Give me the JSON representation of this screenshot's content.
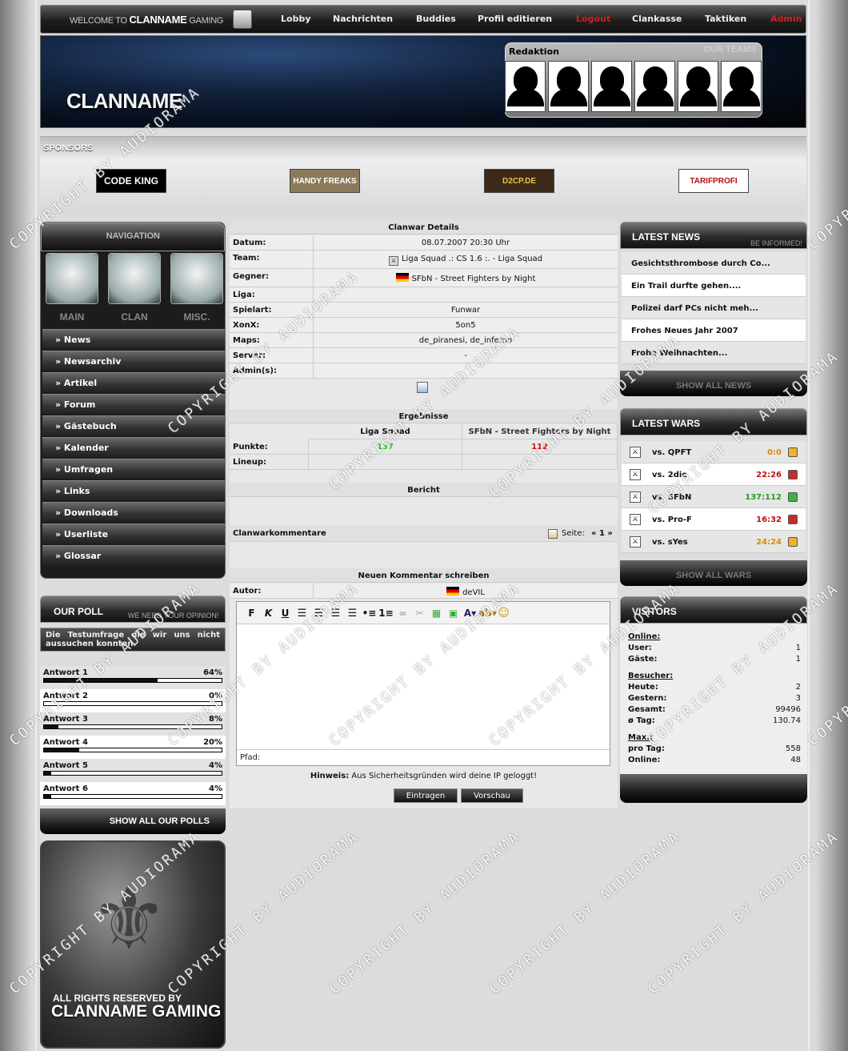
{
  "topnav": {
    "welcome_prefix": "WELCOME TO",
    "welcome_name": "CLANNAME",
    "welcome_suffix": "GAMING",
    "items": [
      "Lobby",
      "Nachrichten",
      "Buddies",
      "Profil editieren",
      "Logout",
      "Clankasse",
      "Taktiken",
      "Admin"
    ]
  },
  "header": {
    "logo": "CLANNAME",
    "redaktion": "Redaktion",
    "our_teams": "OUR TEAMS"
  },
  "sponsors": {
    "title": "SPONSORS",
    "items": [
      "CODE KING",
      "HANDY FREAKS",
      "D2CP.DE",
      "TARIFPROFI"
    ]
  },
  "nav": {
    "title": "NAVIGATION",
    "categories": [
      "MAIN",
      "CLAN",
      "MISC."
    ],
    "items": [
      "» News",
      "» Newsarchiv",
      "» Artikel",
      "» Forum",
      "» Gästebuch",
      "» Kalender",
      "» Umfragen",
      "» Links",
      "» Downloads",
      "» Userliste",
      "» Glossar"
    ]
  },
  "poll": {
    "title": "OUR POLL",
    "tagline": "WE NEED YOUR OPINION!",
    "question": "Die Testumfrage die wir uns nicht aussuchen konnten.",
    "answers": [
      {
        "label": "Antwort 1",
        "pct": "64%",
        "value": 64
      },
      {
        "label": "Antwort 2",
        "pct": "0%",
        "value": 0
      },
      {
        "label": "Antwort 3",
        "pct": "8%",
        "value": 8
      },
      {
        "label": "Antwort 4",
        "pct": "20%",
        "value": 20
      },
      {
        "label": "Antwort 5",
        "pct": "4%",
        "value": 4
      },
      {
        "label": "Antwort 6",
        "pct": "4%",
        "value": 4
      }
    ],
    "show_all": "SHOW ALL OUR POLLS"
  },
  "footer": {
    "logo_text": "LOGO",
    "rights": "ALL RIGHTS RESERVED BY",
    "name": "CLANNAME GAMING"
  },
  "clanwar": {
    "title": "Clanwar Details",
    "rows": [
      {
        "k": "Datum:",
        "v": "08.07.2007 20:30 Uhr"
      },
      {
        "k": "Team:",
        "v": "Liga Squad .: CS 1.6 :. - Liga Squad"
      },
      {
        "k": "Gegner:",
        "v": "SFbN - Street Fighters by Night"
      },
      {
        "k": "Liga:",
        "v": ""
      },
      {
        "k": "Spielart:",
        "v": "Funwar"
      },
      {
        "k": "XonX:",
        "v": "5on5"
      },
      {
        "k": "Maps:",
        "v": "de_piranesi, de_inferno"
      },
      {
        "k": "Server:",
        "v": "-"
      },
      {
        "k": "Admin(s):",
        "v": ""
      }
    ],
    "results_title": "Ergebnisse",
    "team_a": "Liga Squad",
    "team_b": "SFbN - Street Fighters by Night",
    "points_label": "Punkte:",
    "points_a": "137",
    "points_b": "112",
    "lineup_label": "Lineup:",
    "report_title": "Bericht",
    "comments_title": "Clanwarkommentare",
    "pages_label": "Seite:",
    "pages": "« 1 »",
    "new_comment_title": "Neuen Kommentar schreiben",
    "author_label": "Autor:",
    "author": "deVIL",
    "path_label": "Pfad:",
    "hint_bold": "Hinweis:",
    "hint": "Aus Sicherheitsgründen wird deine IP geloggt!",
    "submit": "Eintragen",
    "preview": "Vorschau"
  },
  "news": {
    "title": "LATEST NEWS",
    "tagline": "BE INFORMED!",
    "items": [
      "Gesichtsthrombose durch Co...",
      "Ein Trail durfte gehen....",
      "Polizei darf PCs nicht meh...",
      "Frohes Neues Jahr 2007",
      "Frohe Weihnachten..."
    ],
    "show_all": "SHOW ALL NEWS"
  },
  "wars": {
    "title": "LATEST WARS",
    "items": [
      {
        "vs": "vs. QPFT",
        "score": "0:0",
        "color": "#e08a00",
        "status": "#f0b030"
      },
      {
        "vs": "vs. 2die",
        "score": "22:26",
        "color": "#c01010",
        "status": "#c03030"
      },
      {
        "vs": "vs. SFbN",
        "score": "137:112",
        "color": "#20a020",
        "status": "#40b040"
      },
      {
        "vs": "vs. Pro-F",
        "score": "16:32",
        "color": "#c01010",
        "status": "#c03030"
      },
      {
        "vs": "vs. sYes",
        "score": "24:24",
        "color": "#e08a00",
        "status": "#f0b030"
      }
    ],
    "show_all": "SHOW ALL WARS"
  },
  "visitors": {
    "title": "VISITORS",
    "online_h": "Online:",
    "user_l": "User:",
    "user_v": "1",
    "guest_l": "Gäste:",
    "guest_v": "1",
    "besucher_h": "Besucher:",
    "today_l": "Heute:",
    "today_v": "2",
    "yday_l": "Gestern:",
    "yday_v": "3",
    "total_l": "Gesamt:",
    "total_v": "99496",
    "avg_l": "ø Tag:",
    "avg_v": "130.74",
    "max_h": "Max.:",
    "perday_l": "pro Tag:",
    "perday_v": "558",
    "maxonline_l": "Online:",
    "maxonline_v": "48"
  },
  "watermark": "COPYRIGHT BY AUDIORAMA"
}
